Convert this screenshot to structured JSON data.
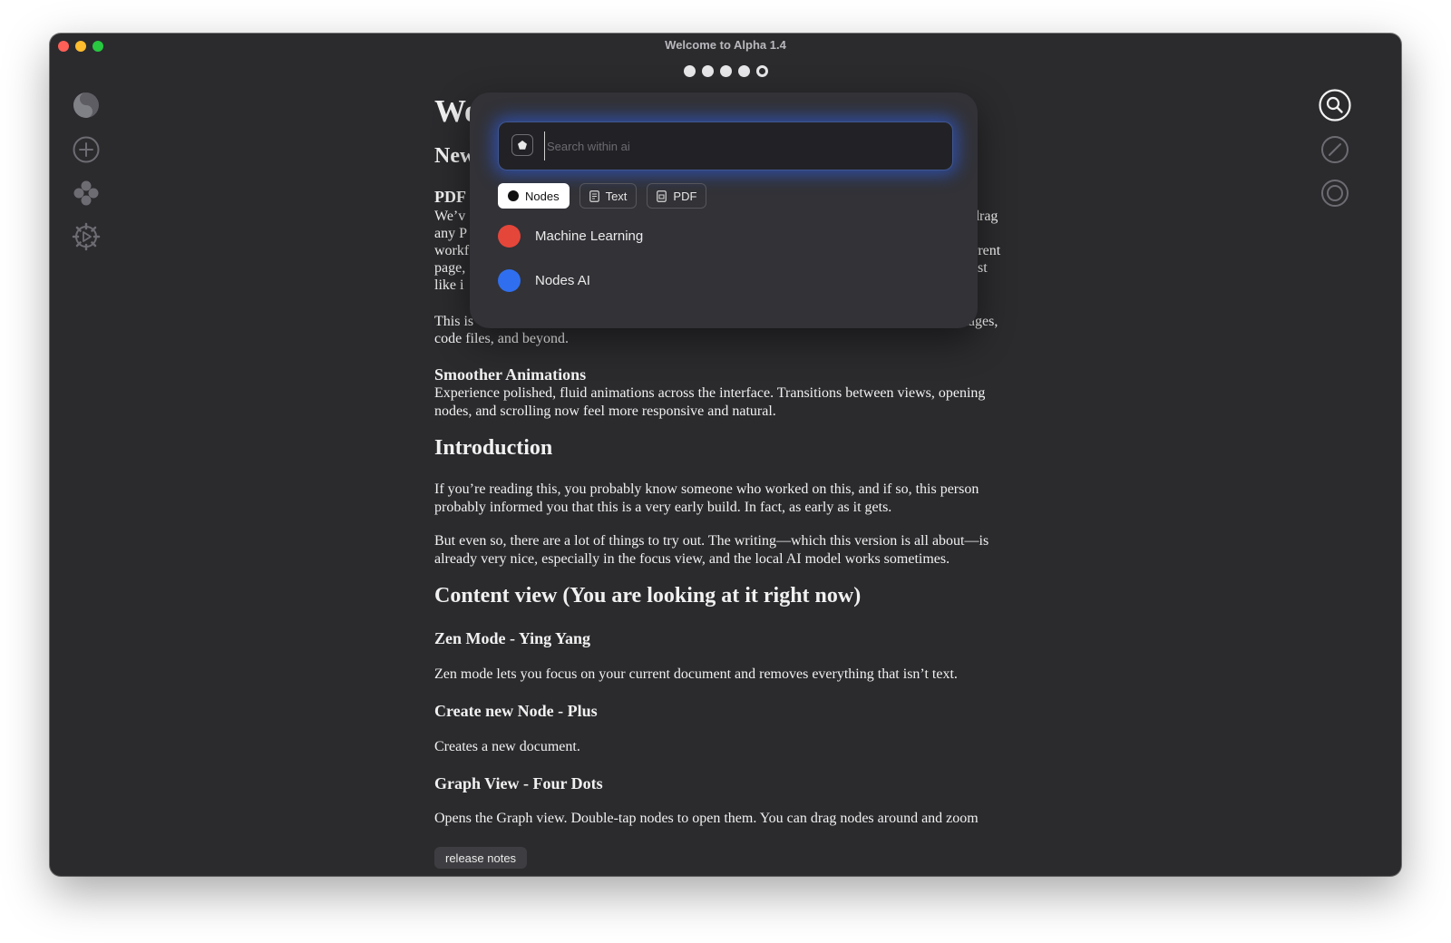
{
  "window": {
    "title": "Welcome to Alpha 1.4",
    "pager_active_index": 4
  },
  "left_toolbar": [
    "yin-yang-icon",
    "plus-circle-icon",
    "four-dots-icon",
    "gear-icon"
  ],
  "right_toolbar": [
    "search-icon",
    "pen-icon",
    "focus-icon"
  ],
  "document": {
    "title_visible": "We",
    "section_visible": "New",
    "pdf_heading_visible": "PDF",
    "pdf_left_lines": [
      "We’v",
      "any P",
      "workf",
      "page,",
      "like i"
    ],
    "pdf_right_fragments": [
      "drag",
      "urrent",
      "ust"
    ],
    "this_is_left": "This is",
    "this_is_right": "images,",
    "code_files_line": "code files, and beyond.",
    "smoother_heading": "Smoother Animations",
    "smoother_text": "Experience polished, fluid animations across the interface. Transitions between views, opening nodes, and scrolling now feel more responsive and natural.",
    "intro_heading": "Introduction",
    "intro_p1": "If you’re reading this, you probably know someone who worked on this, and if so, this person probably informed you that this is a very early build. In fact, as early as it gets.",
    "intro_p2": "But even so, there are a lot of things to try out. The writing—which this version is all about—is already very nice, especially in the focus view, and the local AI model works sometimes.",
    "content_heading": "Content view (You are looking at it right now)",
    "zen_heading": "Zen Mode - Ying Yang",
    "zen_text": "Zen mode lets you focus on your current document and removes everything that isn’t text.",
    "create_heading": "Create new Node - Plus",
    "create_text": "Creates a new document.",
    "graph_heading": "Graph View - Four Dots",
    "graph_text": "Opens the Graph view. Double-tap nodes to open them. You can drag nodes around and zoom"
  },
  "release_button": "release notes",
  "search_popover": {
    "placeholder": "Search within ai",
    "value": "",
    "filters": [
      {
        "label": "Nodes",
        "icon": "dot-icon",
        "active": true
      },
      {
        "label": "Text",
        "icon": "text-doc-icon",
        "active": false
      },
      {
        "label": "PDF",
        "icon": "pdf-doc-icon",
        "active": false
      }
    ],
    "results": [
      {
        "label": "Machine Learning",
        "color": "#e5463a"
      },
      {
        "label": "Nodes AI",
        "color": "#2f6fef"
      }
    ]
  }
}
